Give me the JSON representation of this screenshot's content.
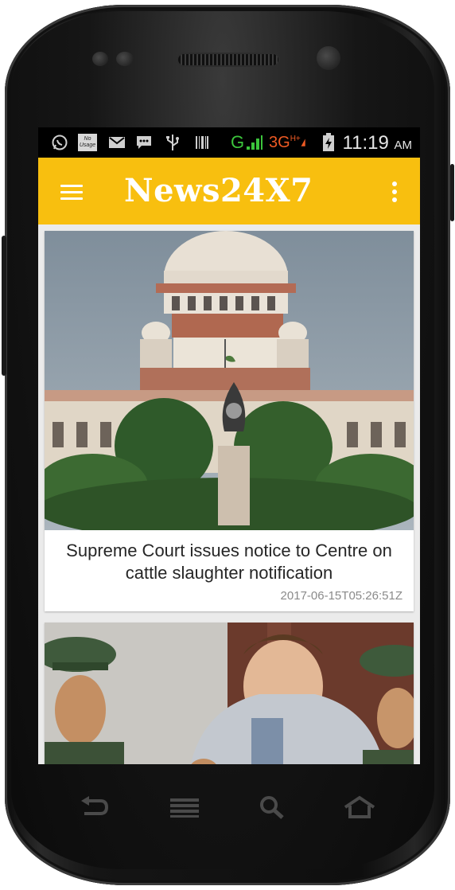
{
  "status_bar": {
    "icons": [
      "whatsapp-icon",
      "no-usage-icon",
      "gmail-icon",
      "chat-icon",
      "usb-icon",
      "barcode-icon",
      "signal-icon",
      "network-3g-icon",
      "battery-charging-icon"
    ],
    "carrier_letter": "G",
    "network_type": "3G",
    "network_suffix": "H+",
    "badge_text": "No Usage",
    "time": "11:19",
    "ampm": "AM"
  },
  "app_bar": {
    "title": "News24X7",
    "background_color": "#f8bf0f"
  },
  "feed": {
    "items": [
      {
        "headline": "Supreme Court issues notice to Centre on cattle slaughter notification",
        "timestamp": "2017-06-15T05:26:51Z",
        "image": "supreme-court-building-photo"
      },
      {
        "image": "detained-student-photo"
      }
    ]
  },
  "nav_keys": [
    "back-icon",
    "menu-icon",
    "search-icon",
    "home-icon"
  ]
}
